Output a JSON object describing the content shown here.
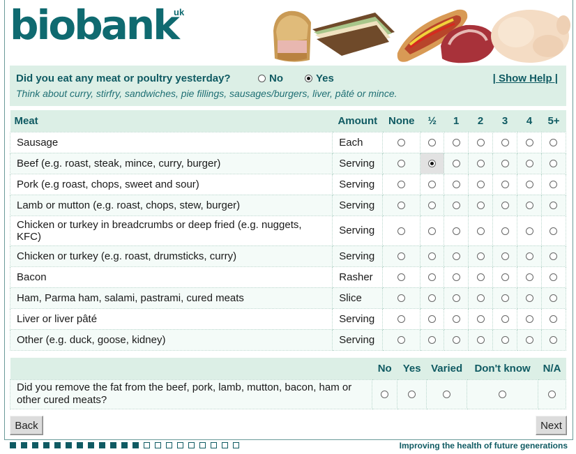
{
  "header": {
    "logo_text": "biobank",
    "logo_suffix": "uk"
  },
  "question": {
    "text": "Did you eat any meat or poultry yesterday?",
    "options": [
      {
        "label": "No",
        "selected": false
      },
      {
        "label": "Yes",
        "selected": true
      }
    ],
    "show_help": "| Show Help |",
    "hint": "Think about curry, stirfry, sandwiches, pie fillings, sausages/burgers, liver, pâté or mince."
  },
  "meat_table": {
    "headers": [
      "Meat",
      "Amount",
      "None",
      "½",
      "1",
      "2",
      "3",
      "4",
      "5+"
    ],
    "rows": [
      {
        "item": "Sausage",
        "amount": "Each",
        "selected": null
      },
      {
        "item": "Beef (e.g. roast, steak, mince, curry, burger)",
        "amount": "Serving",
        "selected": "½"
      },
      {
        "item": "Pork (e.g roast, chops, sweet and sour)",
        "amount": "Serving",
        "selected": null
      },
      {
        "item": "Lamb or mutton (e.g. roast, chops, stew, burger)",
        "amount": "Serving",
        "selected": null
      },
      {
        "item": "Chicken or turkey in breadcrumbs or deep fried (e.g. nuggets, KFC)",
        "amount": "Serving",
        "selected": null
      },
      {
        "item": "Chicken or turkey (e.g. roast, drumsticks, curry)",
        "amount": "Serving",
        "selected": null
      },
      {
        "item": "Bacon",
        "amount": "Rasher",
        "selected": null
      },
      {
        "item": "Ham, Parma ham, salami, pastrami, cured meats",
        "amount": "Slice",
        "selected": null
      },
      {
        "item": "Liver or liver pâté",
        "amount": "Serving",
        "selected": null
      },
      {
        "item": "Other (e.g. duck, goose, kidney)",
        "amount": "Serving",
        "selected": null
      }
    ]
  },
  "fat_table": {
    "headers": [
      "No",
      "Yes",
      "Varied",
      "Don't know",
      "N/A"
    ],
    "question": "Did you remove the fat from the beef, pork, lamb, mutton, bacon, ham or other cured meats?",
    "selected": null
  },
  "nav": {
    "back_label": "Back",
    "next_label": "Next"
  },
  "footer": {
    "progress_done": 12,
    "progress_total": 21,
    "tagline": "Improving the health of future generations"
  },
  "colors": {
    "brand": "#0f6a70",
    "header_bg": "#dcefe6",
    "row_alt": "#f4fbf8"
  }
}
